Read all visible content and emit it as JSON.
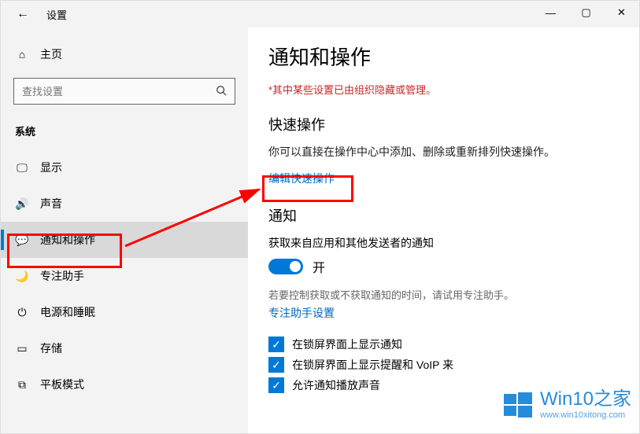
{
  "titlebar": {
    "back_glyph": "←",
    "title": "设置"
  },
  "window_controls": {
    "min": "—",
    "max": "▢",
    "close": "✕"
  },
  "sidebar": {
    "home": "主页",
    "search_placeholder": "查找设置",
    "category": "系统",
    "items": [
      {
        "label": "显示",
        "icon": "🖵"
      },
      {
        "label": "声音",
        "icon": "🔊"
      },
      {
        "label": "通知和操作",
        "icon": "💬",
        "active": true
      },
      {
        "label": "专注助手",
        "icon": "🌙"
      },
      {
        "label": "电源和睡眠",
        "icon": "⏻"
      },
      {
        "label": "存储",
        "icon": "▭"
      },
      {
        "label": "平板模式",
        "icon": "⧉"
      }
    ]
  },
  "main": {
    "page_title": "通知和操作",
    "warning": "*其中某些设置已由组织隐藏或管理。",
    "quick_actions": {
      "heading": "快速操作",
      "desc": "你可以直接在操作中心中添加、删除或重新排列快速操作。",
      "link": "编辑快速操作"
    },
    "notifications": {
      "heading": "通知",
      "toggle_label": "获取来自应用和其他发送者的通知",
      "toggle_state": "开",
      "focus_hint": "若要控制获取或不获取通知的时间，请试用专注助手。",
      "focus_link": "专注助手设置",
      "checkboxes": [
        "在锁屏界面上显示通知",
        "在锁屏界面上显示提醒和 VoIP 来",
        "允许通知播放声音"
      ]
    }
  },
  "watermark": {
    "main": "Win10之家",
    "sub": "www.win10xitong.com"
  }
}
